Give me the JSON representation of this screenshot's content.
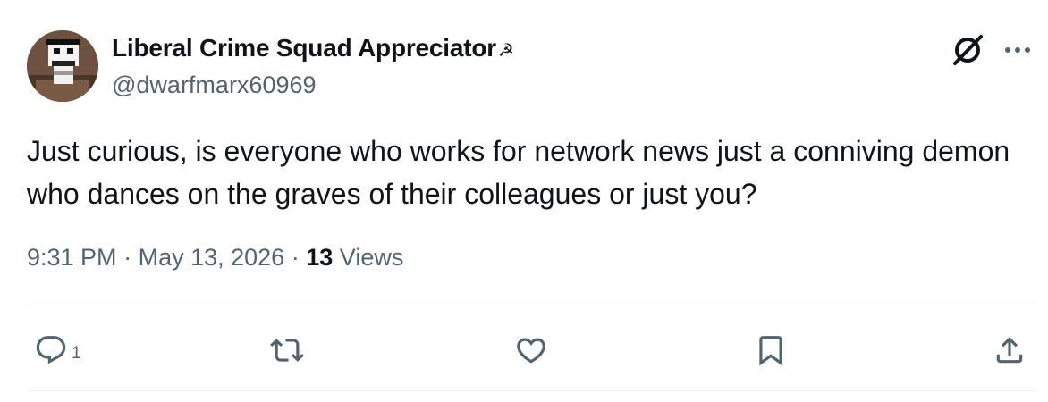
{
  "author": {
    "display_name": "Liberal Crime Squad Appreciator",
    "badge": "☭",
    "handle": "@dwarfmarx60969"
  },
  "tweet": {
    "text": "Just curious, is everyone who works for network news just a conniving demon who dances on the graves of their colleagues or just you?",
    "time": "9:31 PM",
    "separator": "·",
    "date": "May 13, 2026",
    "views_count": "13",
    "views_label": "Views"
  },
  "actions": {
    "reply_count": "1",
    "reply_icon": "reply-icon",
    "retweet_icon": "retweet-icon",
    "like_icon": "heart-icon",
    "bookmark_icon": "bookmark-icon",
    "share_icon": "share-icon"
  },
  "top_icons": [
    "grok-icon",
    "more-icon"
  ],
  "colors": {
    "text": "#0f1419",
    "secondary": "#536471",
    "divider": "#eff3f4",
    "background": "#ffffff"
  }
}
